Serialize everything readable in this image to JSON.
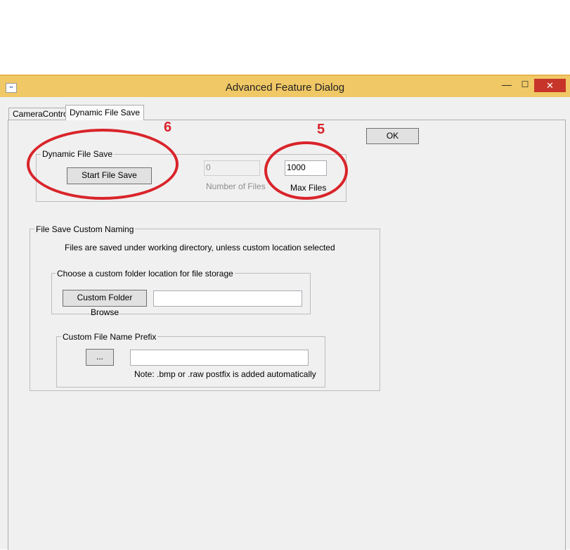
{
  "window": {
    "title": "Advanced Feature Dialog",
    "minimize_glyph": "—",
    "maximize_glyph": "☐",
    "close_glyph": "✕",
    "accent_color": "#f0c865"
  },
  "tabs": [
    {
      "label": "CameraControl",
      "active": false
    },
    {
      "label": "Dynamic File Save",
      "active": true
    }
  ],
  "ok_label": "OK",
  "dynamic_file_save": {
    "group_label": "Dynamic File Save",
    "start_button": "Start File Save",
    "number_of_files_value": "0",
    "number_of_files_label": "Number of Files",
    "max_files_value": "1000",
    "max_files_label": "Max Files"
  },
  "custom_naming": {
    "group_label": "File Save Custom Naming",
    "info_text": "Files are saved under working directory, unless custom location selected",
    "folder_group_label": "Choose a custom folder location for file storage",
    "browse_button": "Custom Folder Browse",
    "folder_value": "",
    "prefix_group_label": "Custom File Name Prefix",
    "prefix_button": "...",
    "prefix_value": "",
    "note": "Note: .bmp or .raw postfix is added automatically"
  },
  "annotations": {
    "label_6": "6",
    "label_5": "5",
    "color": "#d9242a"
  }
}
